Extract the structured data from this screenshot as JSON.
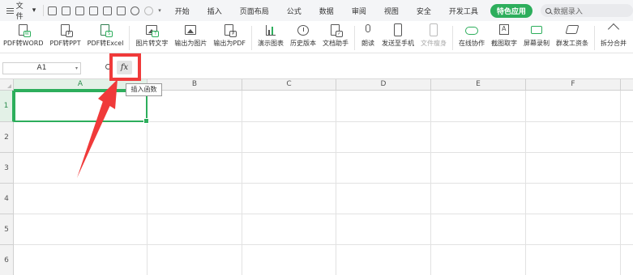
{
  "menubar": {
    "file_label": "文件",
    "tabs": [
      "开始",
      "插入",
      "页面布局",
      "公式",
      "数据",
      "审阅",
      "视图",
      "安全",
      "开发工具"
    ],
    "special_tab": "特色应用",
    "search_placeholder": "数据录入"
  },
  "ribbon": {
    "buttons": [
      {
        "label": "PDF转WORD",
        "icon": "pdf-to-word-icon"
      },
      {
        "label": "PDF转PPT",
        "icon": "pdf-to-ppt-icon"
      },
      {
        "label": "PDF转Excel",
        "icon": "pdf-to-excel-icon"
      },
      {
        "label": "图片转文字",
        "icon": "image-to-text-icon"
      },
      {
        "label": "输出为图片",
        "icon": "export-image-icon"
      },
      {
        "label": "输出为PDF",
        "icon": "export-pdf-icon"
      },
      {
        "label": "演示图表",
        "icon": "chart-icon"
      },
      {
        "label": "历史版本",
        "icon": "history-icon"
      },
      {
        "label": "文档助手",
        "icon": "doc-assistant-icon"
      },
      {
        "label": "朗读",
        "icon": "microphone-icon"
      },
      {
        "label": "发送至手机",
        "icon": "phone-icon"
      },
      {
        "label": "文件瘦身",
        "icon": "file-slim-icon"
      },
      {
        "label": "在线协作",
        "icon": "cloud-collab-icon"
      },
      {
        "label": "截图取字",
        "icon": "screenshot-ocr-icon"
      },
      {
        "label": "屏幕录制",
        "icon": "screen-record-icon"
      },
      {
        "label": "群发工资条",
        "icon": "payslip-icon"
      },
      {
        "label": "拆分合并",
        "icon": "split-merge-icon"
      }
    ]
  },
  "formula_bar": {
    "name_box": "A1",
    "fx_label": "fx",
    "tooltip": "插入函数"
  },
  "sheet": {
    "columns": [
      "A",
      "B",
      "C",
      "D",
      "E",
      "F"
    ],
    "rows": [
      "1",
      "2",
      "3",
      "4",
      "5",
      "6"
    ],
    "active_cell": "A1"
  },
  "colors": {
    "accent_green": "#2dae5c",
    "annotation_red": "#f03a3a"
  }
}
